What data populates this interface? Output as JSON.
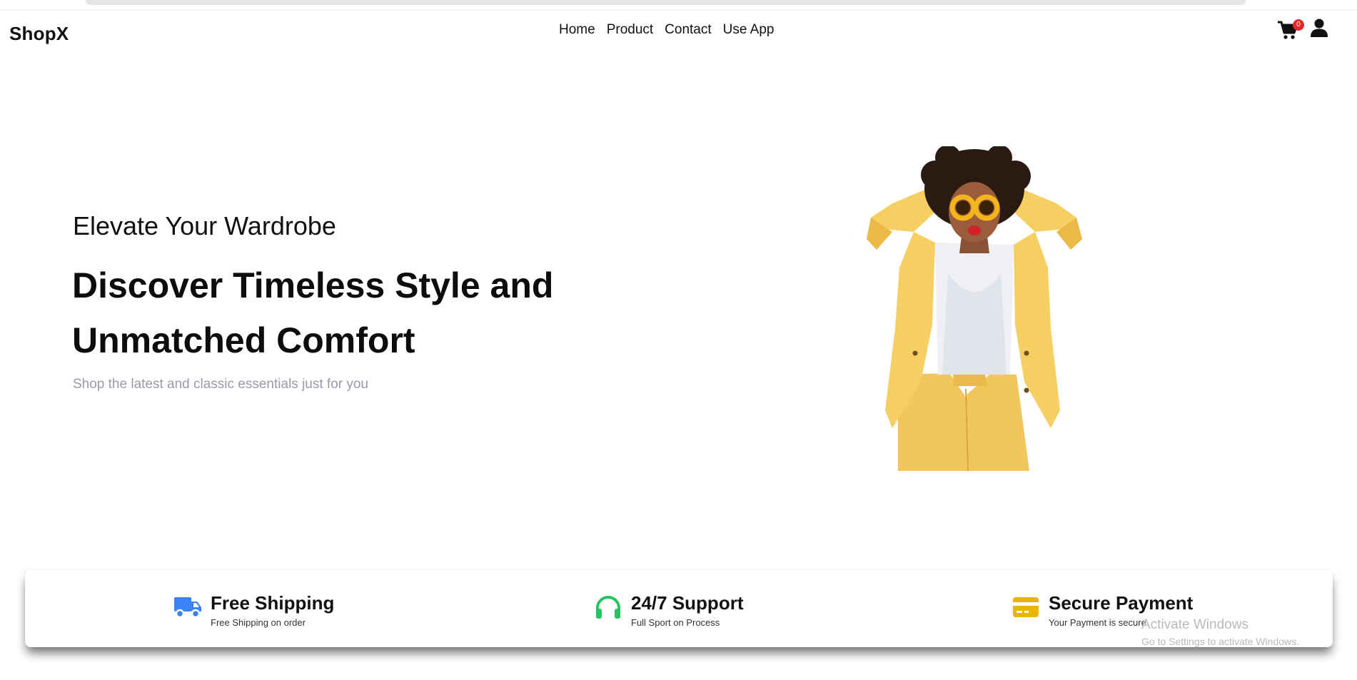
{
  "brand": "ShopX",
  "nav": {
    "items": [
      {
        "label": "Home"
      },
      {
        "label": "Product"
      },
      {
        "label": "Contact"
      },
      {
        "label": "Use App"
      }
    ]
  },
  "cart": {
    "count": "0",
    "icon": "cart-icon"
  },
  "user": {
    "icon": "user-icon"
  },
  "hero": {
    "eyebrow": "Elevate Your Wardrobe",
    "title_line1": "Discover Timeless Style and",
    "title_line2": "Unmatched Comfort",
    "subtitle": "Shop the latest and classic essentials just for you",
    "image_alt": "Woman in yellow suit with yellow sunglasses"
  },
  "features": [
    {
      "title": "Free Shipping",
      "desc": "Free Shipping on order",
      "icon": "truck-icon",
      "color": "#3b82f6"
    },
    {
      "title": "24/7 Support",
      "desc": "Full Sport on Process",
      "icon": "headphones-icon",
      "color": "#22c55e"
    },
    {
      "title": "Secure Payment",
      "desc": "Your Payment is secure",
      "icon": "credit-card-icon",
      "color": "#eab308"
    }
  ],
  "watermark": {
    "line1": "Activate Windows",
    "line2": "Go to Settings to activate Windows."
  }
}
